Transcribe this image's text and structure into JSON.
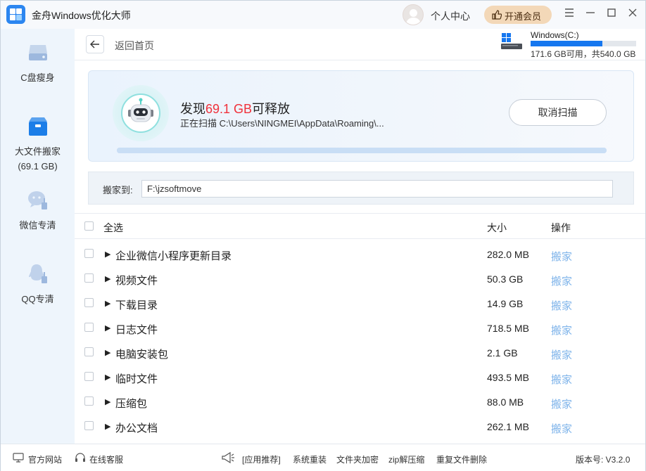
{
  "app": {
    "title": "金舟Windows优化大师"
  },
  "topbar": {
    "user_center": "个人中心",
    "vip_button": "开通会员",
    "window_controls": [
      "menu-icon",
      "minimize-icon",
      "maximize-icon",
      "close-icon"
    ]
  },
  "sidebar": {
    "items": [
      {
        "label": "C盘瘦身",
        "icon": "disk-icon"
      },
      {
        "label": "大文件搬家",
        "sub": "(69.1 GB)",
        "icon": "box-icon",
        "active": true
      },
      {
        "label": "微信专清",
        "icon": "wechat-clean-icon"
      },
      {
        "label": "QQ专清",
        "icon": "qq-clean-icon"
      }
    ]
  },
  "header": {
    "back_label": "返回首页",
    "drive": {
      "name": "Windows(C:)",
      "info": "171.6 GB可用，共540.0 GB",
      "used_fraction": 0.68
    }
  },
  "scan": {
    "title_prefix": "发现",
    "title_value": "69.1 GB",
    "title_suffix": "可释放",
    "path": "正在扫描 C:\\Users\\NINGMEI\\AppData\\Roaming\\...",
    "cancel_label": "取消扫描",
    "progress": 1.0
  },
  "move": {
    "label": "搬家到:",
    "path": "F:\\jzsoftmove"
  },
  "table": {
    "headers": {
      "select_all": "全选",
      "size": "大小",
      "action": "操作"
    },
    "rows": [
      {
        "name": "企业微信小程序更新目录",
        "size": "282.0 MB",
        "action": "搬家"
      },
      {
        "name": "视频文件",
        "size": "50.3 GB",
        "action": "搬家"
      },
      {
        "name": "下载目录",
        "size": "14.9 GB",
        "action": "搬家"
      },
      {
        "name": "日志文件",
        "size": "718.5 MB",
        "action": "搬家"
      },
      {
        "name": "电脑安装包",
        "size": "2.1 GB",
        "action": "搬家"
      },
      {
        "name": "临时文件",
        "size": "493.5 MB",
        "action": "搬家"
      },
      {
        "name": "压缩包",
        "size": "88.0 MB",
        "action": "搬家"
      },
      {
        "name": "办公文档",
        "size": "262.1 MB",
        "action": "搬家"
      }
    ]
  },
  "footer": {
    "official_site": "官方网站",
    "online_service": "在线客服",
    "recommend": "[应用推荐]",
    "links": [
      "系统重装",
      "文件夹加密",
      "zip解压缩",
      "重复文件删除"
    ],
    "version": "版本号: V3.2.0"
  },
  "colors": {
    "accent": "#1677ef",
    "highlight": "#f0303a",
    "vip": "#f3d8b8",
    "link": "#7fb4ea"
  }
}
